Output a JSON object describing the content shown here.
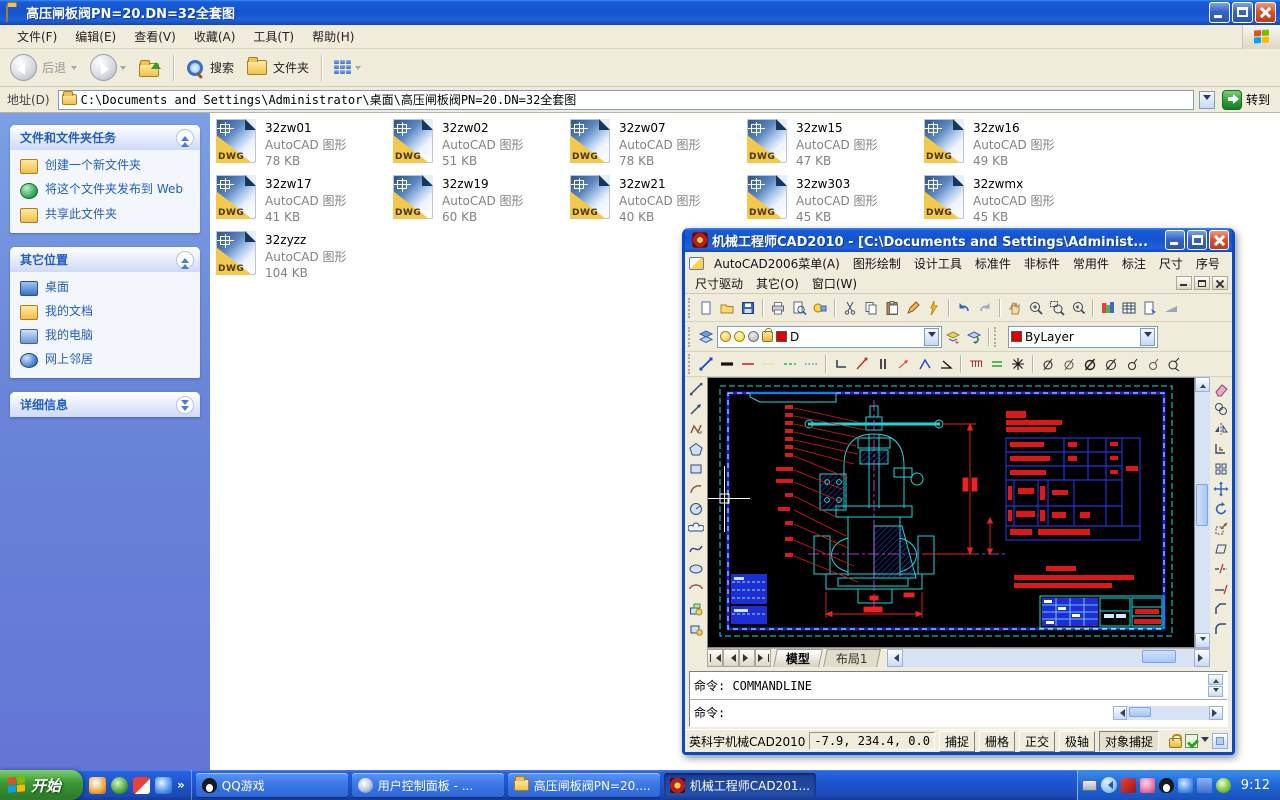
{
  "explorer": {
    "title": "高压闸板阀PN=20.DN=32全套图",
    "menu": [
      "文件(F)",
      "编辑(E)",
      "查看(V)",
      "收藏(A)",
      "工具(T)",
      "帮助(H)"
    ],
    "toolbar": {
      "back": "后退",
      "search": "搜索",
      "folders": "文件夹"
    },
    "address_label": "地址(D)",
    "address_value": "C:\\Documents and Settings\\Administrator\\桌面\\高压闸板阀PN=20.DN=32全套图",
    "go_label": "转到"
  },
  "sidebar": {
    "panel1": {
      "title": "文件和文件夹任务",
      "items": [
        "创建一个新文件夹",
        "将这个文件夹发布到 Web",
        "共享此文件夹"
      ]
    },
    "panel2": {
      "title": "其它位置",
      "items": [
        "桌面",
        "我的文档",
        "我的电脑",
        "网上邻居"
      ]
    },
    "panel3": {
      "title": "详细信息"
    }
  },
  "files": {
    "dwg_label": "DWG",
    "type_label": "AutoCAD 图形",
    "items": [
      {
        "name": "32zw01",
        "size": "78 KB"
      },
      {
        "name": "32zw02",
        "size": "51 KB"
      },
      {
        "name": "32zw07",
        "size": "78 KB"
      },
      {
        "name": "32zw15",
        "size": "47 KB"
      },
      {
        "name": "32zw16",
        "size": "49 KB"
      },
      {
        "name": "32zw17",
        "size": "41 KB"
      },
      {
        "name": "32zw19",
        "size": "60 KB"
      },
      {
        "name": "32zw21",
        "size": "40 KB"
      },
      {
        "name": "32zw303",
        "size": "45 KB"
      },
      {
        "name": "32zwmx",
        "size": "45 KB"
      },
      {
        "name": "32zyzz",
        "size": "104 KB"
      }
    ]
  },
  "cad": {
    "title": "机械工程师CAD2010 - [C:\\Documents and Settings\\Administ...",
    "menu_row1": [
      "AutoCAD2006菜单(A)",
      "图形绘制",
      "设计工具",
      "标准件",
      "非标件",
      "常用件",
      "标注",
      "尺寸",
      "序号"
    ],
    "menu_row2": [
      "尺寸驱动",
      "其它(O)",
      "窗口(W)"
    ],
    "layer_value": "D",
    "color_value": "ByLayer",
    "tabs": [
      "模型",
      "布局1"
    ],
    "command_line1": "命令: COMMANDLINE",
    "command_line2": "命令:",
    "status": {
      "brand": "英科宇机械CAD2010",
      "coords": "-7.9,  234.4, 0.0",
      "toggles": [
        "捕捉",
        "栅格",
        "正交",
        "极轴",
        "对象捕捉"
      ]
    }
  },
  "taskbar": {
    "start_label": "开始",
    "quick_chevron": "»",
    "tasks": [
      "QQ游戏",
      "用户控制面板 - ...",
      "高压闸板阀PN=20....",
      "机械工程师CAD201..."
    ],
    "time": "9:12"
  },
  "icons": [
    "folder-icon",
    "back-icon",
    "forward-icon",
    "up-icon",
    "search-icon",
    "folders-icon",
    "views-icon",
    "go-icon",
    "new-folder-icon",
    "publish-web-icon",
    "share-folder-icon",
    "desktop-icon",
    "my-documents-icon",
    "my-computer-icon",
    "network-icon",
    "dwg-file-icon",
    "cad-app-icon",
    "new-icon",
    "open-icon",
    "save-icon",
    "print-icon",
    "preview-icon",
    "find-icon",
    "cut-icon",
    "copy-icon",
    "paste-icon",
    "pen-icon",
    "match-icon",
    "undo-icon",
    "redo-icon",
    "pan-icon",
    "zoom-realtime-icon",
    "zoom-window-icon",
    "zoom-previous-icon",
    "render-icon",
    "table-icon",
    "sheet-icon",
    "layers-icon",
    "bulb-icon",
    "sun-icon",
    "printer-state-icon",
    "lock-icon",
    "color-swatch-icon",
    "line-icon",
    "polyline-icon",
    "polygon-icon",
    "rectangle-icon",
    "arc-icon",
    "circle-icon",
    "cloud-icon",
    "spline-icon",
    "ellipse-icon",
    "block-icon",
    "erase-icon",
    "mirror-icon",
    "offset-icon",
    "array-icon",
    "move-icon",
    "rotate-icon",
    "scale-icon",
    "stretch-icon",
    "trim-icon",
    "extend-icon",
    "chamfer-icon",
    "fillet-icon",
    "diameter-icon",
    "keyboard-tray-icon",
    "qq-penguin-icon",
    "clock"
  ]
}
